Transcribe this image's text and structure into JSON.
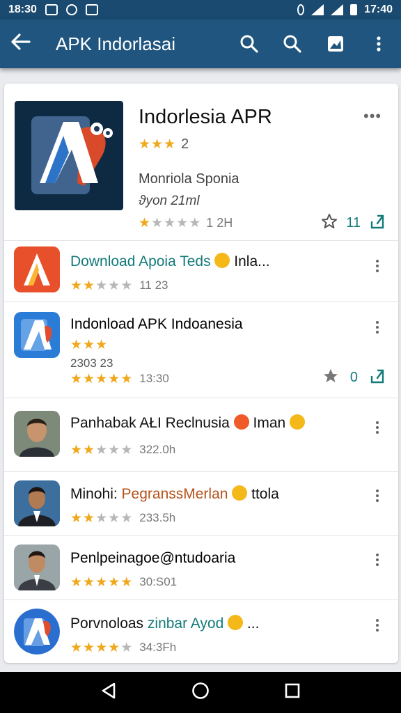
{
  "status_bar": {
    "time": "18:30",
    "right_time": "17:40"
  },
  "app_bar": {
    "title": "APK Indorlasai",
    "icons": [
      "back-arrow-icon",
      "search-icon",
      "search-icon",
      "image-icon",
      "overflow-menu-icon"
    ]
  },
  "featured": {
    "name": "Indorlesia APR",
    "rating_value": "2",
    "stars": 3,
    "developer": "Monriola Sponia",
    "subtitle": "ϑyon 21ml",
    "bottom_text": "1 2H",
    "bottom_stars": 1,
    "favorite_count": "11"
  },
  "items": [
    {
      "title": "Download Apoia Teds",
      "title_suffix": "Inla...",
      "title_color": "#137a7a",
      "stars": 2,
      "meta": "11 23",
      "icon": "orange-a-app-icon",
      "has_emoji": true
    },
    {
      "title": "Indonload APK Indoanesia",
      "title_color": "#111111",
      "stars": 3,
      "extra_line": "2303 23",
      "stars2": 5,
      "meta": "13:30",
      "icon": "blue-a-app-icon",
      "favorite_count": "0"
    },
    {
      "title": "Panhabak AŁI Reclnusia",
      "title_suffix": "Iman",
      "title_color": "#111111",
      "stars": 2,
      "meta": "322.0h",
      "icon": "person-avatar-icon",
      "has_emoji": true
    },
    {
      "title": "Minohi:",
      "title_mid": "PegranssMerlan",
      "title_suffix": "ttola",
      "title_color": "#111111",
      "mid_color": "#b5521a",
      "stars": 2,
      "meta": "233.5h",
      "icon": "person-avatar-icon",
      "has_emoji": true
    },
    {
      "title": "Penlpeinagoe@ntudoaria",
      "title_color": "#137a7a",
      "stars": 5,
      "meta": "30:S01",
      "icon": "person-avatar-icon"
    },
    {
      "title": "Porvnoloas",
      "title_mid": "zinbar Ayod",
      "title_suffix": "...",
      "title_color": "#111111",
      "mid_color": "#137a7a",
      "stars": 4,
      "meta": "34:3Fh",
      "icon": "blue-a-app-icon",
      "has_emoji": true
    }
  ],
  "nav": {
    "icons": [
      "back-triangle-icon",
      "home-circle-icon",
      "recents-square-icon"
    ]
  },
  "colors": {
    "app_bar": "#1f557e",
    "status_bar": "#1a4a70",
    "star": "#f0a81c",
    "teal": "#137a7a"
  }
}
